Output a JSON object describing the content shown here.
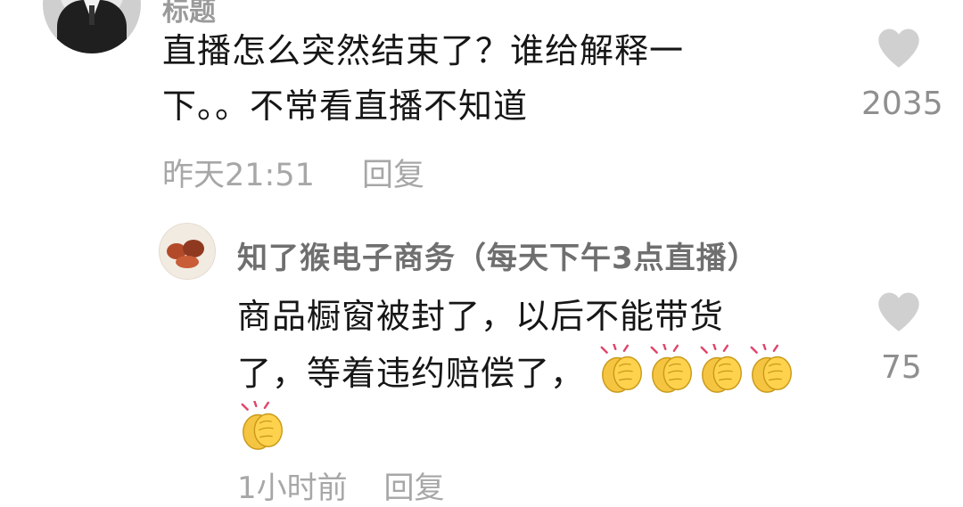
{
  "top_comment": {
    "username": "标题",
    "text_line1": "直播怎么突然结束了？谁给解释一",
    "text_line2": "下。。不常看直播不知道",
    "time": "昨天21:51",
    "reply_label": "回复",
    "like_count": "2035"
  },
  "reply_comment": {
    "username": "知了猴电子商务（每天下午3点直播）",
    "text_line1": "商品橱窗被封了，以后不能带货",
    "text_line2": "了，等着违约赔偿了，",
    "emoji_count": 5,
    "like_count": "75",
    "time": "1小时前",
    "reply_label": "回复"
  },
  "icons": {
    "like": "heart-icon",
    "emoji": "clapping-hands-emoji"
  },
  "colors": {
    "heart": "#cfcfcf",
    "meta_text": "#a7a7a7",
    "username": "#6f6f6f"
  }
}
